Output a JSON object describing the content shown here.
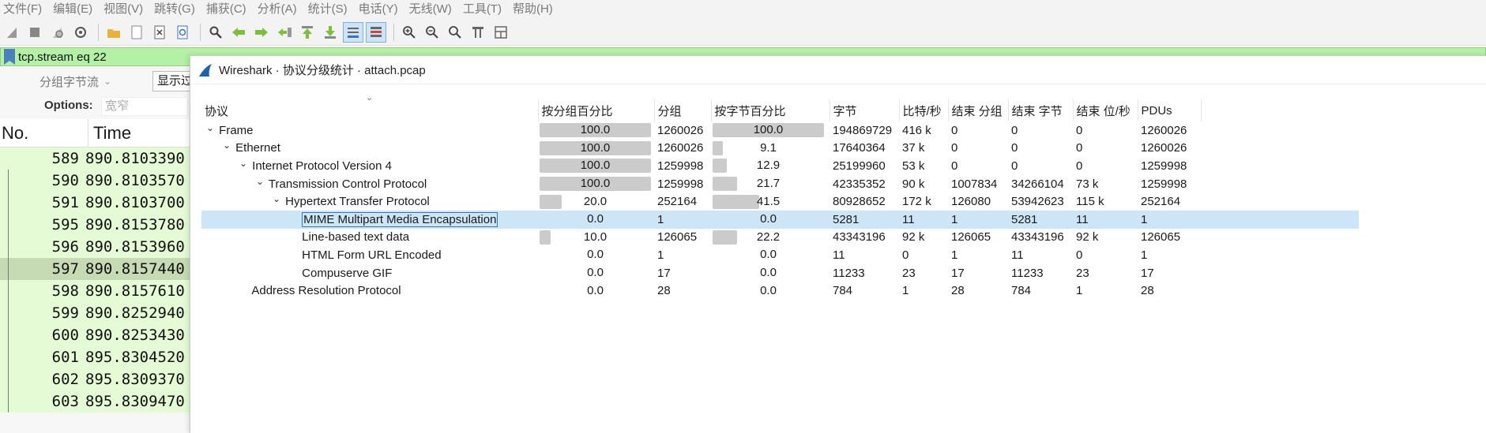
{
  "menu": [
    "文件(F)",
    "编辑(E)",
    "视图(V)",
    "跳转(G)",
    "捕获(C)",
    "分析(A)",
    "统计(S)",
    "电话(Y)",
    "无线(W)",
    "工具(T)",
    "帮助(H)"
  ],
  "filter": {
    "value": "tcp.stream eq 22"
  },
  "left": {
    "byte_stream_label": "分组字节流",
    "display_button": "显示过",
    "options_label": "Options:",
    "options_placeholder": "宽窄",
    "col_no": "No.",
    "col_time": "Time",
    "rows": [
      {
        "no": "589",
        "time": "890.8103390"
      },
      {
        "no": "590",
        "time": "890.8103570"
      },
      {
        "no": "591",
        "time": "890.8103700"
      },
      {
        "no": "595",
        "time": "890.8153780"
      },
      {
        "no": "596",
        "time": "890.8153960"
      },
      {
        "no": "597",
        "time": "890.8157440"
      },
      {
        "no": "598",
        "time": "890.8157610"
      },
      {
        "no": "599",
        "time": "890.8252940"
      },
      {
        "no": "600",
        "time": "890.8253430"
      },
      {
        "no": "601",
        "time": "895.8304520"
      },
      {
        "no": "602",
        "time": "895.8309370"
      },
      {
        "no": "603",
        "time": "895.8309470"
      }
    ]
  },
  "dialog": {
    "title": "Wireshark · 协议分级统计 · attach.pcap",
    "columns": [
      "协议",
      "按分组百分比",
      "分组",
      "按字节百分比",
      "字节",
      "比特/秒",
      "结束 分组",
      "结束 字节",
      "结束 位/秒",
      "PDUs"
    ],
    "rows": [
      {
        "indent": 0,
        "twisty": "v",
        "protocol": "Frame",
        "pkt_pct": "100.0",
        "pkt_pct_val": 100,
        "packets": "1260026",
        "byte_pct": "100.0",
        "byte_pct_val": 100,
        "bytes": "194869729",
        "bps": "416 k",
        "end_pkts": "0",
        "end_bytes": "0",
        "end_bps": "0",
        "pdus": "1260026"
      },
      {
        "indent": 1,
        "twisty": "v",
        "protocol": "Ethernet",
        "pkt_pct": "100.0",
        "pkt_pct_val": 100,
        "packets": "1260026",
        "byte_pct": "9.1",
        "byte_pct_val": 9.1,
        "bytes": "17640364",
        "bps": "37 k",
        "end_pkts": "0",
        "end_bytes": "0",
        "end_bps": "0",
        "pdus": "1260026"
      },
      {
        "indent": 2,
        "twisty": "v",
        "protocol": "Internet Protocol Version 4",
        "pkt_pct": "100.0",
        "pkt_pct_val": 100,
        "packets": "1259998",
        "byte_pct": "12.9",
        "byte_pct_val": 12.9,
        "bytes": "25199960",
        "bps": "53 k",
        "end_pkts": "0",
        "end_bytes": "0",
        "end_bps": "0",
        "pdus": "1259998"
      },
      {
        "indent": 3,
        "twisty": "v",
        "protocol": "Transmission Control Protocol",
        "pkt_pct": "100.0",
        "pkt_pct_val": 100,
        "packets": "1259998",
        "byte_pct": "21.7",
        "byte_pct_val": 21.7,
        "bytes": "42335352",
        "bps": "90 k",
        "end_pkts": "1007834",
        "end_bytes": "34266104",
        "end_bps": "73 k",
        "pdus": "1259998"
      },
      {
        "indent": 4,
        "twisty": "v",
        "protocol": "Hypertext Transfer Protocol",
        "pkt_pct": "20.0",
        "pkt_pct_val": 20,
        "packets": "252164",
        "byte_pct": "41.5",
        "byte_pct_val": 41.5,
        "bytes": "80928652",
        "bps": "172 k",
        "end_pkts": "126080",
        "end_bytes": "53942623",
        "end_bps": "115 k",
        "pdus": "252164"
      },
      {
        "indent": 5,
        "twisty": "",
        "protocol": "MIME Multipart Media Encapsulation",
        "pkt_pct": "0.0",
        "pkt_pct_val": 0,
        "packets": "1",
        "byte_pct": "0.0",
        "byte_pct_val": 0,
        "bytes": "5281",
        "bps": "11",
        "end_pkts": "1",
        "end_bytes": "5281",
        "end_bps": "11",
        "pdus": "1",
        "selected": true
      },
      {
        "indent": 5,
        "twisty": "",
        "protocol": "Line-based text data",
        "pkt_pct": "10.0",
        "pkt_pct_val": 10,
        "packets": "126065",
        "byte_pct": "22.2",
        "byte_pct_val": 22.2,
        "bytes": "43343196",
        "bps": "92 k",
        "end_pkts": "126065",
        "end_bytes": "43343196",
        "end_bps": "92 k",
        "pdus": "126065"
      },
      {
        "indent": 5,
        "twisty": "",
        "protocol": "HTML Form URL Encoded",
        "pkt_pct": "0.0",
        "pkt_pct_val": 0,
        "packets": "1",
        "byte_pct": "0.0",
        "byte_pct_val": 0,
        "bytes": "11",
        "bps": "0",
        "end_pkts": "1",
        "end_bytes": "11",
        "end_bps": "0",
        "pdus": "1"
      },
      {
        "indent": 5,
        "twisty": "",
        "protocol": "Compuserve GIF",
        "pkt_pct": "0.0",
        "pkt_pct_val": 0,
        "packets": "17",
        "byte_pct": "0.0",
        "byte_pct_val": 0,
        "bytes": "11233",
        "bps": "23",
        "end_pkts": "17",
        "end_bytes": "11233",
        "end_bps": "23",
        "pdus": "17"
      },
      {
        "indent": 2,
        "twisty": "",
        "protocol": "Address Resolution Protocol",
        "pkt_pct": "0.0",
        "pkt_pct_val": 0,
        "packets": "28",
        "byte_pct": "0.0",
        "byte_pct_val": 0,
        "bytes": "784",
        "bps": "1",
        "end_pkts": "28",
        "end_bytes": "784",
        "end_bps": "1",
        "pdus": "28"
      }
    ]
  },
  "colors": {
    "filter_bg": "#b4f0a6",
    "packet_row_bg": "#e4fbd5",
    "selected_row": "#cde6f7",
    "bar": "#cbcbcb"
  }
}
